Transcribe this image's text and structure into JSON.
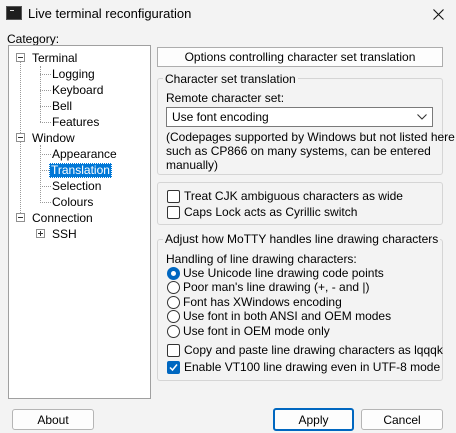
{
  "window": {
    "title": "Live terminal reconfiguration",
    "icon": "terminal-icon",
    "close_icon": "close-icon"
  },
  "category": {
    "label": "Category:",
    "tree": [
      {
        "label": "Terminal",
        "level": 0,
        "expander": "minus"
      },
      {
        "label": "Logging",
        "level": 1
      },
      {
        "label": "Keyboard",
        "level": 1
      },
      {
        "label": "Bell",
        "level": 1
      },
      {
        "label": "Features",
        "level": 1
      },
      {
        "label": "Window",
        "level": 0,
        "expander": "minus"
      },
      {
        "label": "Appearance",
        "level": 1
      },
      {
        "label": "Translation",
        "level": 1,
        "selected": true
      },
      {
        "label": "Selection",
        "level": 1
      },
      {
        "label": "Colours",
        "level": 1
      },
      {
        "label": "Connection",
        "level": 0,
        "expander": "minus"
      },
      {
        "label": "SSH",
        "level": 1,
        "expander": "plus"
      }
    ]
  },
  "panel": {
    "header": "Options controlling character set translation",
    "charset_group": {
      "title": "Character set translation",
      "remote_label": "Remote character set:",
      "selected_value": "Use font encoding",
      "note_lines": [
        "(Codepages supported by Windows but not listed here,",
        "such as CP866 on many systems, can be entered",
        "manually)"
      ]
    },
    "options_group": {
      "checkboxes": [
        {
          "label": "Treat CJK ambiguous characters as wide",
          "checked": false
        },
        {
          "label": "Caps Lock acts as Cyrillic switch",
          "checked": false
        }
      ]
    },
    "linedraw_group": {
      "title": "Adjust how MoTTY handles line drawing characters",
      "handling_label": "Handling of line drawing characters:",
      "radios": [
        {
          "label": "Use Unicode line drawing code points",
          "checked": true
        },
        {
          "label": "Poor man's line drawing (+, - and |)",
          "checked": false
        },
        {
          "label": "Font has XWindows encoding",
          "checked": false
        },
        {
          "label": "Use font in both ANSI and OEM modes",
          "checked": false
        },
        {
          "label": "Use font in OEM mode only",
          "checked": false
        }
      ],
      "checkboxes": [
        {
          "label": "Copy and paste line drawing characters as lqqqk",
          "checked": false
        },
        {
          "label": "Enable VT100 line drawing even in UTF-8 mode",
          "checked": true
        }
      ]
    }
  },
  "buttons": {
    "about": "About",
    "apply": "Apply",
    "cancel": "Cancel"
  },
  "colors": {
    "selection": "#0078d7",
    "accent": "#0067c0"
  }
}
